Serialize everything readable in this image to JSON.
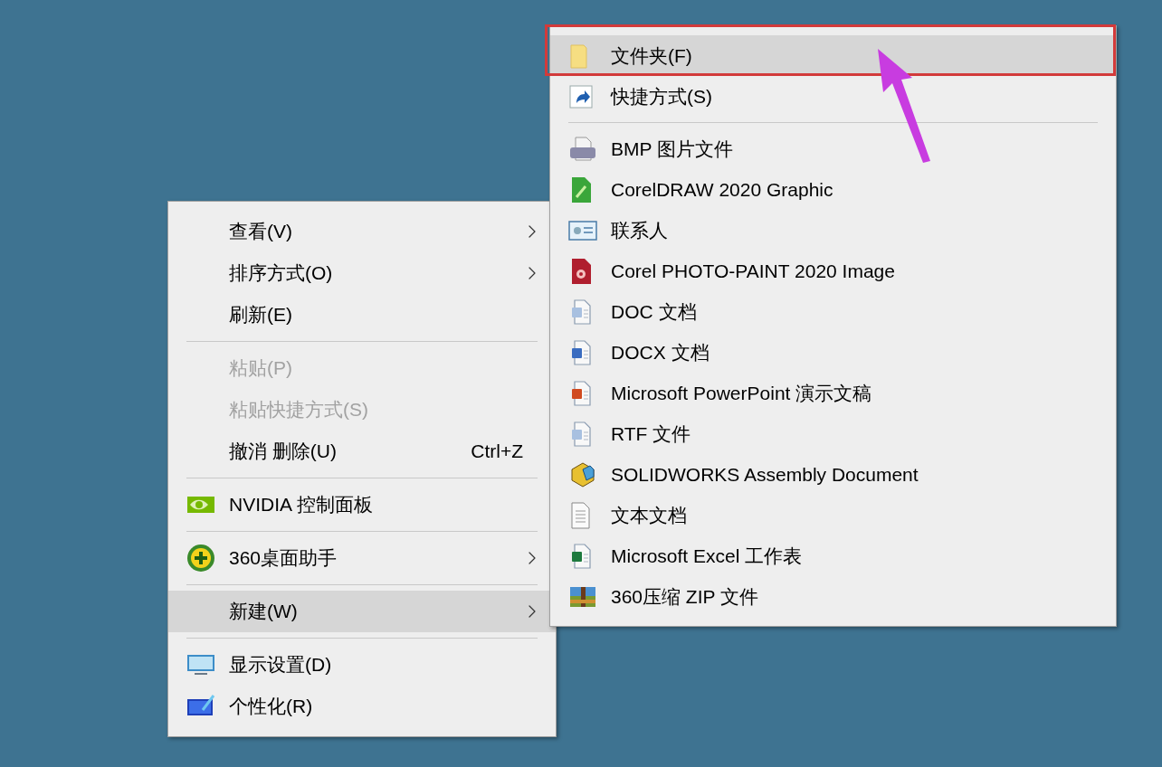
{
  "context_menu": {
    "groups": [
      [
        {
          "label": "查看(V)",
          "submenu": true,
          "disabled": false,
          "selected": false
        },
        {
          "label": "排序方式(O)",
          "submenu": true,
          "disabled": false,
          "selected": false
        },
        {
          "label": "刷新(E)",
          "submenu": false,
          "disabled": false,
          "selected": false
        }
      ],
      [
        {
          "label": "粘贴(P)",
          "submenu": false,
          "disabled": true,
          "selected": false
        },
        {
          "label": "粘贴快捷方式(S)",
          "submenu": false,
          "disabled": true,
          "selected": false
        },
        {
          "label": "撤消 删除(U)",
          "shortcut": "Ctrl+Z",
          "submenu": false,
          "disabled": false,
          "selected": false
        }
      ],
      [
        {
          "label": "NVIDIA 控制面板",
          "submenu": false,
          "disabled": false,
          "selected": false
        }
      ],
      [
        {
          "label": "360桌面助手",
          "submenu": true,
          "disabled": false,
          "selected": false
        }
      ],
      [
        {
          "label": "新建(W)",
          "submenu": true,
          "disabled": false,
          "selected": true
        }
      ],
      [
        {
          "label": "显示设置(D)",
          "submenu": false,
          "disabled": false,
          "selected": false
        },
        {
          "label": "个性化(R)",
          "submenu": false,
          "disabled": false,
          "selected": false
        }
      ]
    ]
  },
  "new_submenu": {
    "groups": [
      [
        {
          "label": "文件夹(F)",
          "submenu": false,
          "disabled": false,
          "selected": true
        },
        {
          "label": "快捷方式(S)",
          "submenu": false,
          "disabled": false,
          "selected": false
        }
      ],
      [
        {
          "label": "BMP 图片文件",
          "submenu": false,
          "disabled": false,
          "selected": false
        },
        {
          "label": "CorelDRAW 2020 Graphic",
          "submenu": false,
          "disabled": false,
          "selected": false
        },
        {
          "label": "联系人",
          "submenu": false,
          "disabled": false,
          "selected": false
        },
        {
          "label": "Corel PHOTO-PAINT 2020 Image",
          "submenu": false,
          "disabled": false,
          "selected": false
        },
        {
          "label": "DOC 文档",
          "submenu": false,
          "disabled": false,
          "selected": false
        },
        {
          "label": "DOCX 文档",
          "submenu": false,
          "disabled": false,
          "selected": false
        },
        {
          "label": "Microsoft PowerPoint 演示文稿",
          "submenu": false,
          "disabled": false,
          "selected": false
        },
        {
          "label": "RTF 文件",
          "submenu": false,
          "disabled": false,
          "selected": false
        },
        {
          "label": "SOLIDWORKS Assembly Document",
          "submenu": false,
          "disabled": false,
          "selected": false
        },
        {
          "label": "文本文档",
          "submenu": false,
          "disabled": false,
          "selected": false
        },
        {
          "label": "Microsoft Excel 工作表",
          "submenu": false,
          "disabled": false,
          "selected": false
        },
        {
          "label": "360压缩 ZIP 文件",
          "submenu": false,
          "disabled": false,
          "selected": false
        }
      ]
    ]
  }
}
